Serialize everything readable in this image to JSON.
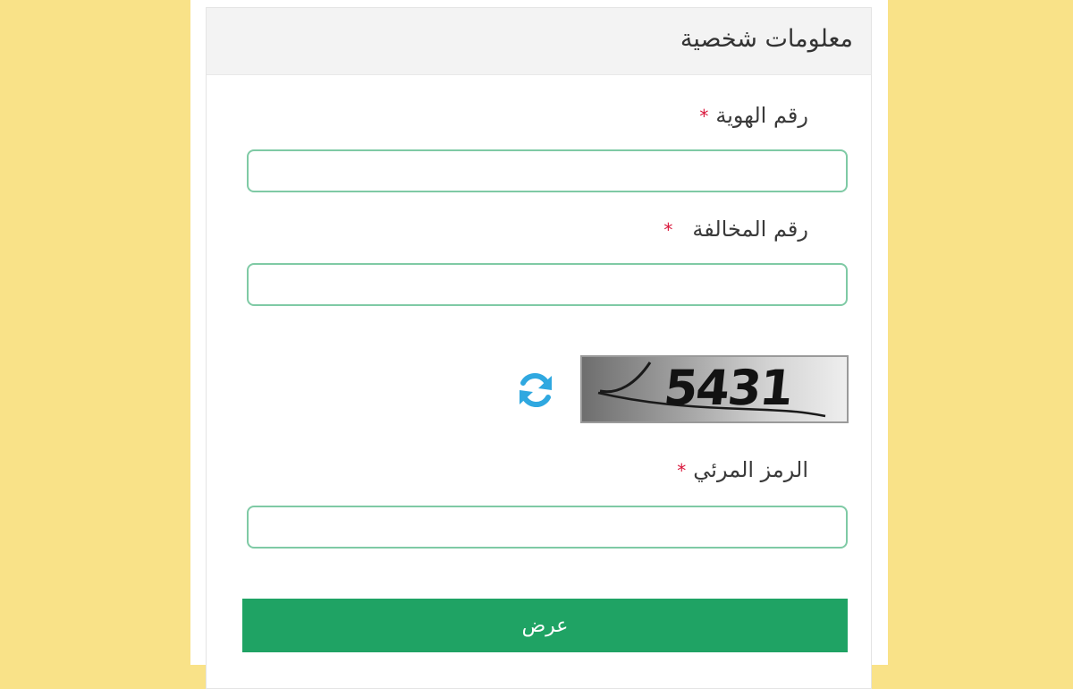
{
  "form": {
    "title": "معلومات شخصية",
    "required_mark": "*",
    "fields": [
      {
        "label": "رقم الهوية",
        "value": "",
        "placeholder": ""
      },
      {
        "label": "رقم المخالفة",
        "value": "",
        "placeholder": ""
      },
      {
        "label": "الرمز المرئي",
        "value": "",
        "placeholder": ""
      }
    ],
    "captcha": {
      "text": "5431",
      "refresh_icon": "refresh-icon"
    },
    "submit_label": "عرض"
  },
  "colors": {
    "background": "#f9e288",
    "input_border": "#7fcaa5",
    "required": "#d9163b",
    "submit": "#1fa364",
    "refresh_icon": "#2fa8e0"
  }
}
